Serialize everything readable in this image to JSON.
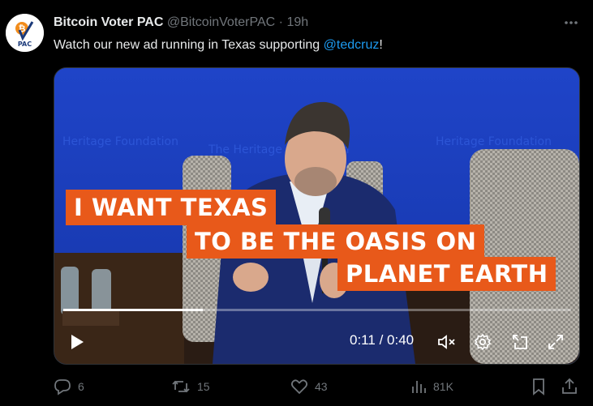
{
  "tweet": {
    "author_name": "Bitcoin Voter PAC",
    "handle": "@BitcoinVoterPAC",
    "separator": "·",
    "time": "19h",
    "text_before": "Watch our new ad running in Texas supporting ",
    "mention": "@tedcruz",
    "text_after": "!",
    "avatar_label": "PAC"
  },
  "video": {
    "captions": [
      "I WANT TEXAS",
      "TO BE THE OASIS ON",
      "PLANET EARTH"
    ],
    "current_time": "0:11",
    "time_separator": "/",
    "duration": "0:40",
    "progress_fraction": 0.275,
    "caption_color": "#e8591a"
  },
  "actions": {
    "replies": "6",
    "reposts": "15",
    "likes": "43",
    "views": "81K"
  },
  "colors": {
    "accent": "#1d9bf0",
    "muted": "#71767b"
  }
}
